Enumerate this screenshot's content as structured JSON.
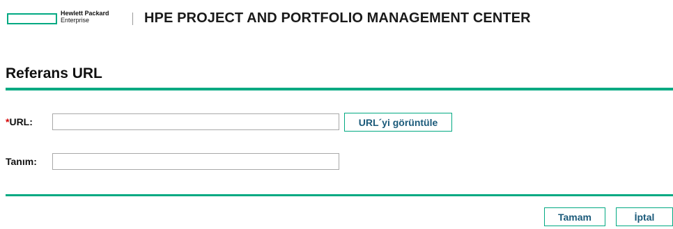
{
  "header": {
    "logo_line1": "Hewlett Packard",
    "logo_line2": "Enterprise",
    "app_title": "HPE PROJECT AND PORTFOLIO MANAGEMENT CENTER"
  },
  "page": {
    "title": "Referans URL"
  },
  "form": {
    "url": {
      "required_marker": "*",
      "label": "URL:",
      "value": "",
      "view_button_label": "URL´yi görüntüle"
    },
    "description": {
      "label": "Tanım:",
      "value": ""
    }
  },
  "footer": {
    "ok_label": "Tamam",
    "cancel_label": "İptal"
  },
  "colors": {
    "accent": "#01a982",
    "button_text": "#1b5a7a",
    "required": "#d40000"
  }
}
